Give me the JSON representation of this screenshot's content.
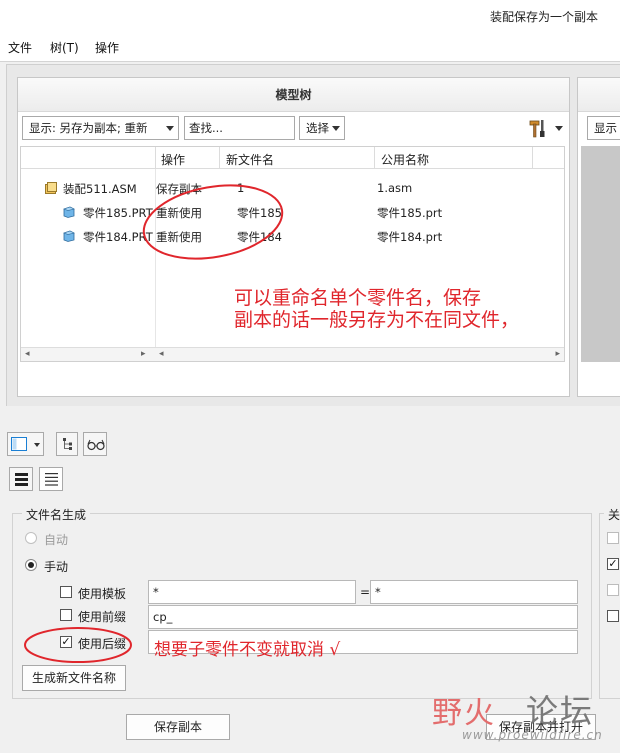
{
  "window": {
    "title": "装配保存为一个副本"
  },
  "menu": {
    "file": "文件",
    "tree": "树(T)",
    "operation": "操作"
  },
  "model_tree": {
    "title": "模型树",
    "display_filter": "显示: 另存为副本; 重新",
    "search_placeholder": "查找...",
    "select_label": "选择",
    "columns": {
      "operation": "操作",
      "new_name": "新文件名",
      "common_name": "公用名称"
    },
    "rows": [
      {
        "name": "装配511.ASM",
        "operation": "保存副本",
        "new_name": "1",
        "common_name": "1.asm"
      },
      {
        "name": "零件185.PRT",
        "operation": "重新使用",
        "new_name": "零件185",
        "common_name": "零件185.prt"
      },
      {
        "name": "零件184.PRT",
        "operation": "重新使用",
        "new_name": "零件184",
        "common_name": "零件184.prt"
      }
    ]
  },
  "right_panel": {
    "display_label": "显示"
  },
  "filename_generation": {
    "group_title": "文件名生成",
    "auto_label": "自动",
    "manual_label": "手动",
    "use_template_label": "使用模板",
    "use_prefix_label": "使用前缀",
    "use_suffix_label": "使用后缀",
    "template_value_left": "*",
    "equals_sign": "=",
    "template_value_right": "*",
    "prefix_value": "cp_",
    "suffix_value": "",
    "generate_button": "生成新文件名称"
  },
  "right_group": {
    "title": "关"
  },
  "buttons": {
    "save_copy": "保存副本",
    "save_copy_open": "保存副本并打开"
  },
  "annotations": {
    "note_rename_line1": "可以重命名单个零件名，保存",
    "note_rename_line2": "副本的话一般另存为不在同文件，",
    "note_suffix": "想要子零件不变就取消 √"
  },
  "watermark": {
    "brand_red": "野火",
    "brand_gray": "论坛",
    "url": "www.proewildfire.cn"
  },
  "colors": {
    "annotation_red": "#e0262c",
    "selection_blue": "#1a7fd4"
  },
  "icons": [
    "assembly-icon",
    "part-icon",
    "hammer-tools-icon",
    "layout-icon",
    "tree-nodes-icon",
    "glasses-icon",
    "list-view-icon"
  ]
}
